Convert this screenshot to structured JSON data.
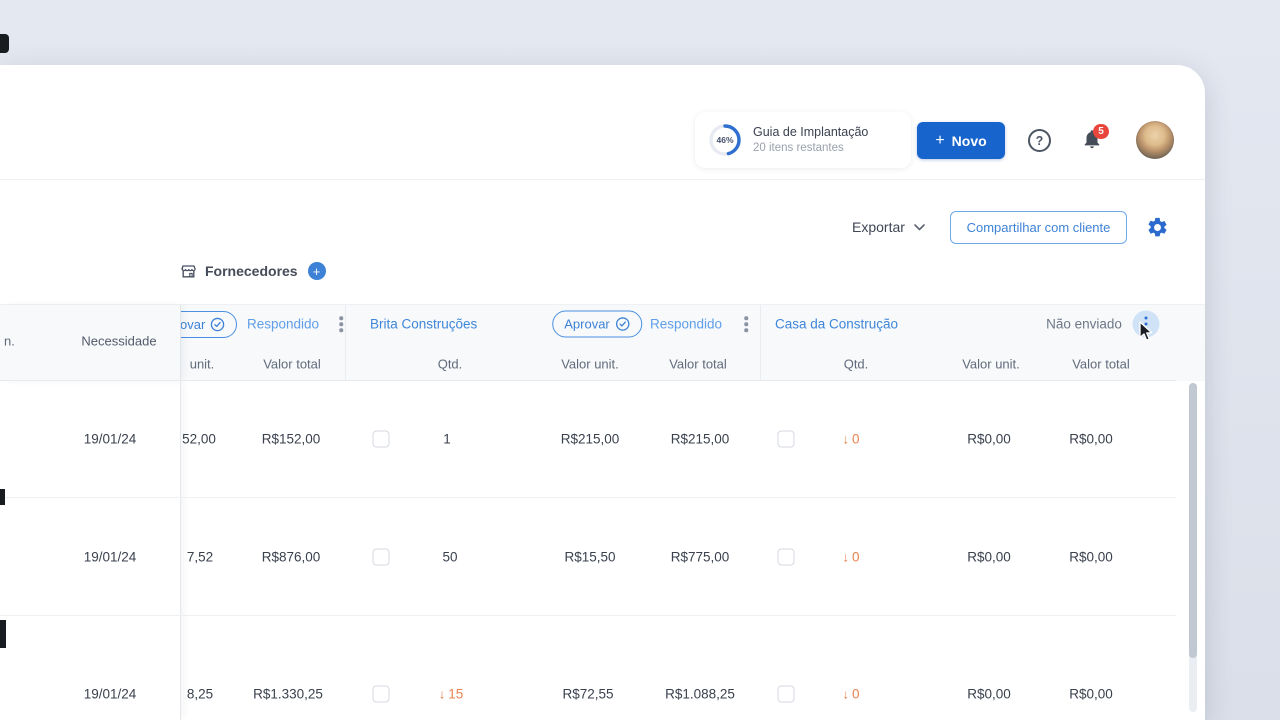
{
  "colors": {
    "primary_blue": "#1765cc",
    "link_blue": "#3d82d6",
    "light_blue_status": "#5f9ee8",
    "warn_orange": "#e8824f",
    "badge_red": "#e8453c"
  },
  "topbar": {
    "guide_percent": "46%",
    "guide_title": "Guia de Implantação",
    "guide_subtitle": "20 itens restantes",
    "new_icon": "+",
    "new_label": "Novo",
    "help_label": "?",
    "notification_count": "5"
  },
  "toolbar": {
    "export_label": "Exportar",
    "share_label": "Compartilhar com cliente"
  },
  "suppliers_bar": {
    "label": "Fornecedores",
    "add_icon": "+"
  },
  "icons": {
    "arrow_down": "↓"
  },
  "table": {
    "item_col_label": "n.",
    "need_col_label": "Necessidade",
    "s1": {
      "approve_label": "ovar",
      "status": "Respondido",
      "col_unit": "unit.",
      "col_total": "Valor total"
    },
    "s2": {
      "name": "Brita Construções",
      "approve_label": "Aprovar",
      "status": "Respondido",
      "col_qty": "Qtd.",
      "col_unit": "Valor unit.",
      "col_total": "Valor total"
    },
    "s3": {
      "name": "Casa da Construção",
      "status": "Não enviado",
      "col_qty": "Qtd.",
      "col_unit": "Valor unit.",
      "col_total": "Valor total"
    },
    "rows": [
      {
        "date": "19/01/24",
        "s1_unit": "52,00",
        "s1_total": "R$152,00",
        "s2_qty": "1",
        "s2_unit": "R$215,00",
        "s2_total": "R$215,00",
        "s3_qty": "0",
        "s3_unit": "R$0,00",
        "s3_total": "R$0,00"
      },
      {
        "date": "19/01/24",
        "s1_unit": "7,52",
        "s1_total": "R$876,00",
        "s2_qty": "50",
        "s2_unit": "R$15,50",
        "s2_total": "R$775,00",
        "s3_qty": "0",
        "s3_unit": "R$0,00",
        "s3_total": "R$0,00"
      },
      {
        "date": "19/01/24",
        "s1_unit": "8,25",
        "s1_total": "R$1.330,25",
        "s2_qty": "15",
        "s2_unit": "R$72,55",
        "s2_total": "R$1.088,25",
        "s3_qty": "0",
        "s3_unit": "R$0,00",
        "s3_total": "R$0,00"
      }
    ]
  }
}
